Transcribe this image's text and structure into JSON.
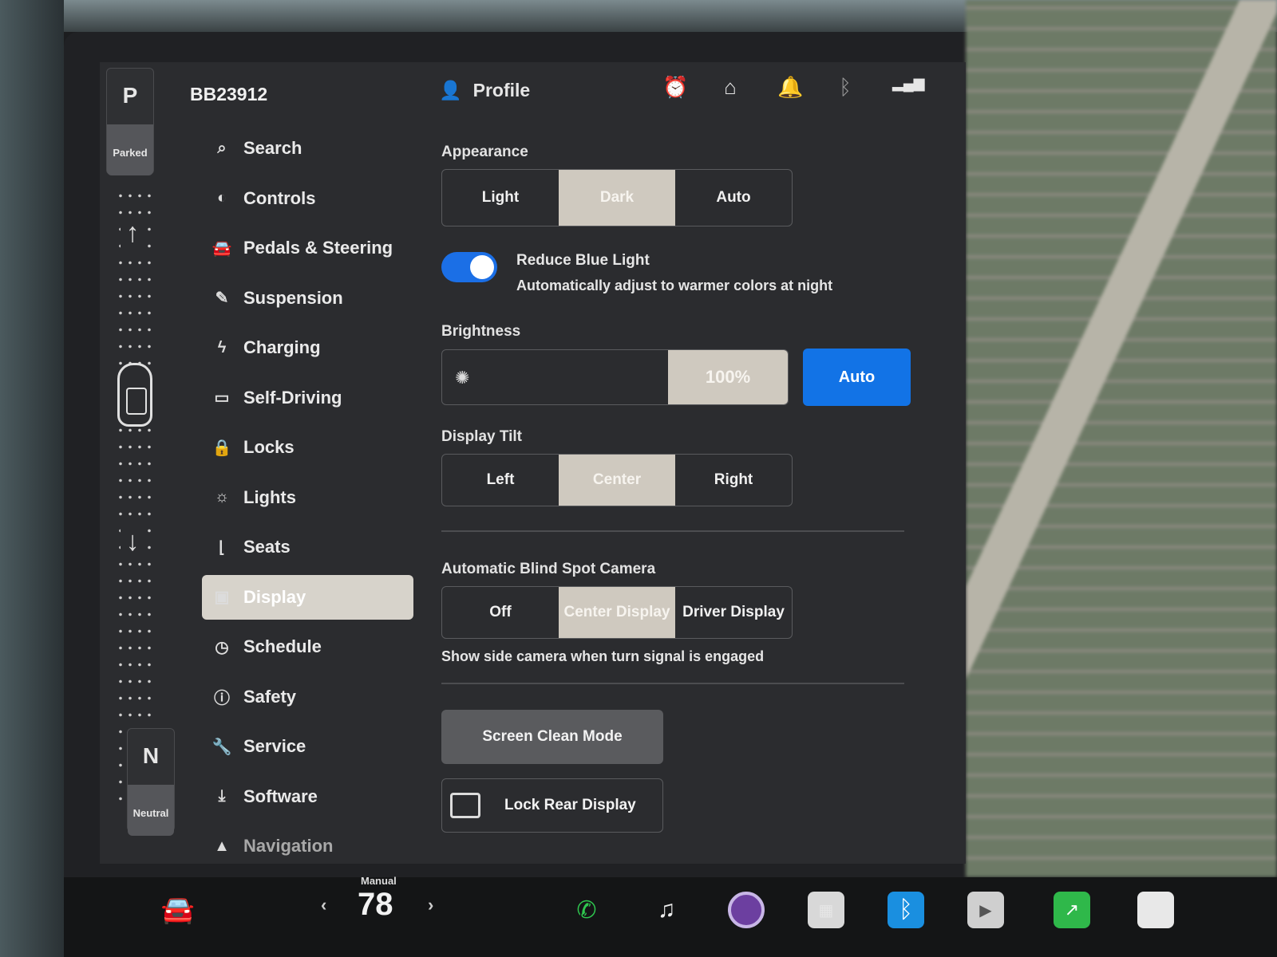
{
  "vehicle": {
    "id": "BB23912"
  },
  "gear": {
    "top_letter": "P",
    "top_label": "Parked",
    "bottom_letter": "N",
    "bottom_label": "Neutral"
  },
  "header": {
    "profile_label": "Profile",
    "icons": [
      "alarm-clock-icon",
      "home-icon",
      "bell-icon",
      "bluetooth-icon",
      "lte-signal-icon"
    ]
  },
  "sidebar": {
    "items": [
      {
        "label": "Search",
        "icon": "search-icon"
      },
      {
        "label": "Controls",
        "icon": "toggle-icon"
      },
      {
        "label": "Pedals & Steering",
        "icon": "car-icon"
      },
      {
        "label": "Suspension",
        "icon": "wrench-pen-icon"
      },
      {
        "label": "Charging",
        "icon": "lightning-icon"
      },
      {
        "label": "Self-Driving",
        "icon": "steering-icon"
      },
      {
        "label": "Locks",
        "icon": "lock-icon"
      },
      {
        "label": "Lights",
        "icon": "sun-icon"
      },
      {
        "label": "Seats",
        "icon": "seat-icon"
      },
      {
        "label": "Display",
        "icon": "display-icon",
        "active": true
      },
      {
        "label": "Schedule",
        "icon": "alarm-icon"
      },
      {
        "label": "Safety",
        "icon": "alert-icon"
      },
      {
        "label": "Service",
        "icon": "wrench-icon"
      },
      {
        "label": "Software",
        "icon": "download-icon"
      },
      {
        "label": "Navigation",
        "icon": "navigation-icon"
      }
    ]
  },
  "display": {
    "appearance": {
      "label": "Appearance",
      "options": [
        "Light",
        "Dark",
        "Auto"
      ],
      "selected": "Dark"
    },
    "reduce_blue_light": {
      "title": "Reduce Blue Light",
      "subtitle": "Automatically adjust to warmer colors at night",
      "enabled": true
    },
    "brightness": {
      "label": "Brightness",
      "value": "100%",
      "level": 1.0,
      "auto_label": "Auto"
    },
    "display_tilt": {
      "label": "Display Tilt",
      "options": [
        "Left",
        "Center",
        "Right"
      ],
      "selected": "Center"
    },
    "blind_spot": {
      "label": "Automatic Blind Spot Camera",
      "options": [
        "Off",
        "Center Display",
        "Driver Display"
      ],
      "selected": "Center Display",
      "note": "Show side camera when turn signal is engaged"
    },
    "screen_clean_label": "Screen Clean Mode",
    "lock_rear_label": "Lock Rear Display"
  },
  "taskbar": {
    "climate_mode": "Manual",
    "temperature": "78",
    "apps": [
      "car-icon",
      "phone-icon",
      "music-icon",
      "camera-icon",
      "apps-icon",
      "bluetooth-icon",
      "video-icon",
      "stocks-icon",
      "notes-icon"
    ]
  },
  "colors": {
    "accent": "#1273e6",
    "selected": "#cfc9bf",
    "panel": "#2b2c2f",
    "phone": "#2fc84f"
  }
}
